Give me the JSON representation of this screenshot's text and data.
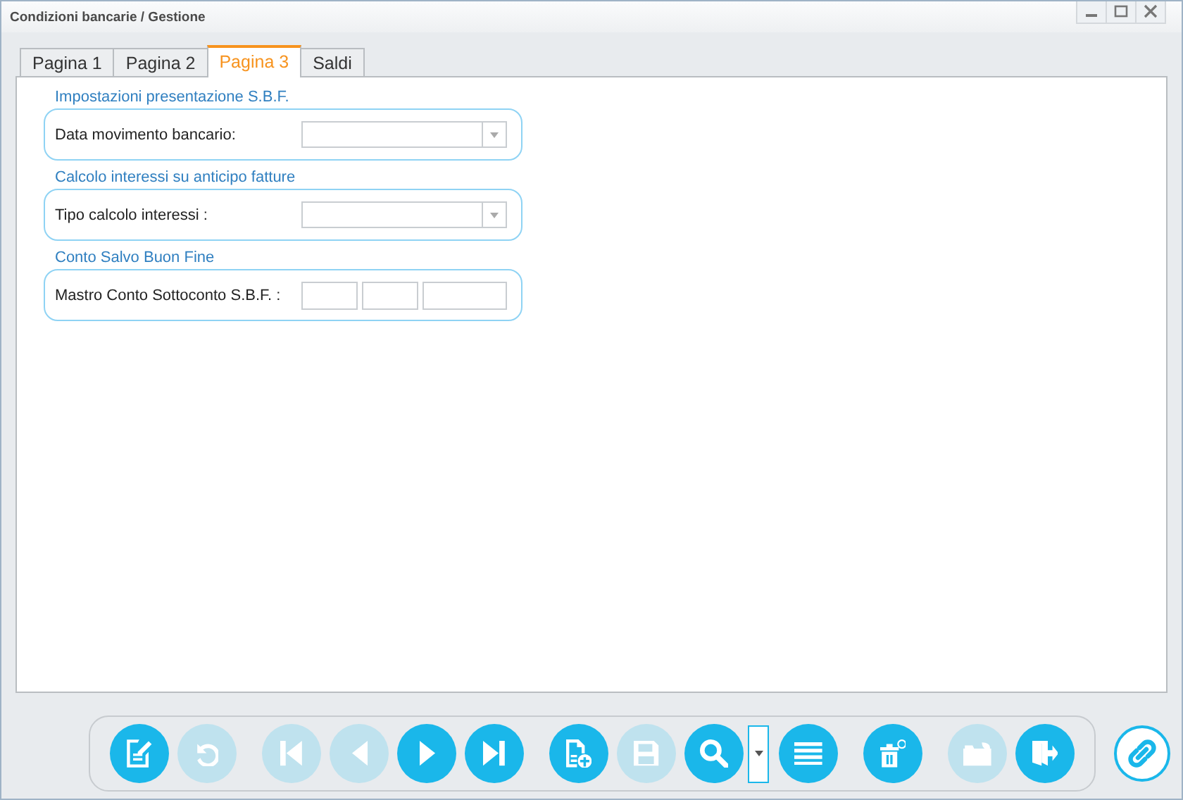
{
  "window": {
    "title": "Condizioni bancarie / Gestione"
  },
  "tabs": [
    {
      "label": "Pagina 1",
      "selected": false
    },
    {
      "label": "Pagina 2",
      "selected": false
    },
    {
      "label": "Pagina 3",
      "selected": true
    },
    {
      "label": "Saldi",
      "selected": false
    }
  ],
  "sections": [
    {
      "title": "Impostazioni presentazione S.B.F.",
      "label": "Data movimento bancario:",
      "fields": [
        {
          "kind": "combo"
        }
      ]
    },
    {
      "title": "Calcolo interessi su anticipo fatture",
      "label": "Tipo calcolo interessi :",
      "fields": [
        {
          "kind": "combo"
        }
      ]
    },
    {
      "title": "Conto Salvo Buon Fine",
      "label": "Mastro Conto Sottoconto S.B.F. :",
      "fields": [
        {
          "kind": "text"
        },
        {
          "kind": "text"
        },
        {
          "kind": "text"
        }
      ]
    }
  ],
  "toolbar": {
    "groups": [
      {
        "buttons": [
          {
            "kind": "edit",
            "disabled": false
          },
          {
            "kind": "undo",
            "disabled": true
          }
        ]
      },
      {
        "buttons": [
          {
            "kind": "first",
            "disabled": true
          },
          {
            "kind": "prev",
            "disabled": true
          },
          {
            "kind": "next",
            "disabled": false
          },
          {
            "kind": "last",
            "disabled": false
          }
        ]
      },
      {
        "buttons": [
          {
            "kind": "new",
            "disabled": false
          },
          {
            "kind": "save",
            "disabled": true
          },
          {
            "kind": "search",
            "disabled": false
          },
          {
            "kind": "dropdown",
            "disabled": false
          },
          {
            "kind": "list",
            "disabled": false
          }
        ]
      },
      {
        "buttons": [
          {
            "kind": "delete",
            "disabled": false
          }
        ]
      },
      {
        "buttons": [
          {
            "kind": "folder",
            "disabled": true
          },
          {
            "kind": "exit",
            "disabled": false
          }
        ]
      }
    ]
  }
}
